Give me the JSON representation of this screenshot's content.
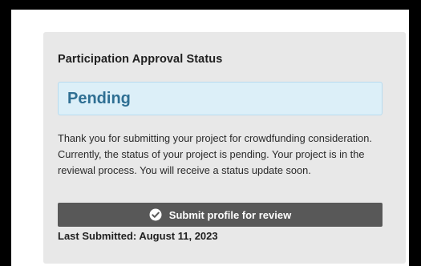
{
  "card": {
    "title": "Participation Approval Status",
    "status": "Pending",
    "description": "Thank you for submitting your project for crowdfunding consideration. Currently, the status of your project is pending. Your project is in the reviewal process. You will receive a status update soon.",
    "submit_button_label": "Submit profile for review",
    "submit_button_icon": "check-circle-icon",
    "last_submitted": "Last Submitted: August 11, 2023"
  },
  "colors": {
    "page_border": "#000000",
    "card_background": "#e8e8e8",
    "status_background": "#dcefF8",
    "status_text": "#2f6f93",
    "button_background": "#585858"
  }
}
